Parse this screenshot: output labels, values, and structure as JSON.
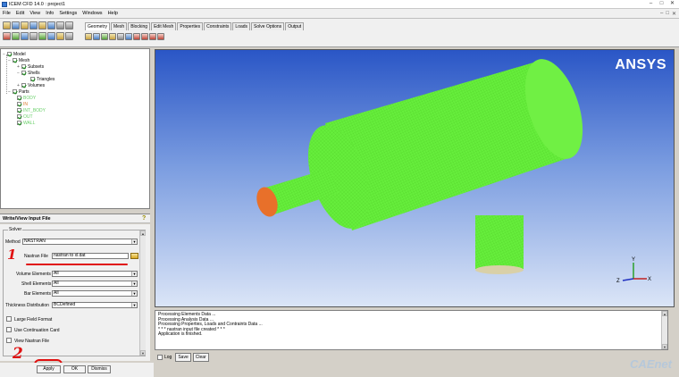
{
  "window": {
    "title": "ICEM CFD 14.0 : project1",
    "controls": [
      "–",
      "□",
      "✕"
    ]
  },
  "menu": {
    "items": [
      "File",
      "Edit",
      "View",
      "Info",
      "Settings",
      "Windows",
      "Help"
    ],
    "right_controls": [
      "–",
      "□",
      "✕"
    ]
  },
  "tabs": [
    "Geometry",
    "Mesh",
    "Blocking",
    "Edit Mesh",
    "Properties",
    "Constraints",
    "Loads",
    "Solve Options",
    "Output"
  ],
  "tree": {
    "model": "Model",
    "mesh": "Mesh",
    "subsets": "Subsets",
    "shells": "Shells",
    "triangles": "Triangles",
    "volumes": "Volumes",
    "parts": "Parts",
    "part_items": [
      "BODY",
      "IN",
      "INT_BODY",
      "OUT",
      "WALL"
    ]
  },
  "panel": {
    "title": "Write/View Input File",
    "solver_legend": "Solver",
    "method_label": "Method",
    "method_value": "NASTRAN",
    "nastran_file_label": "Nastran File",
    "nastran_file_value": "nastran to xl.dat",
    "volume_elements_label": "Volume Elements",
    "volume_elements_value": "All",
    "shell_elements_label": "Shell Elements",
    "shell_elements_value": "All",
    "bar_elements_label": "Bar Elements",
    "bar_elements_value": "All",
    "thickness_label": "Thickness Distribution",
    "thickness_value": "BCDefined",
    "large_field_label": "Large Field Format",
    "continuation_label": "Use Continuation Card",
    "view_nastran_label": "View Nastran File"
  },
  "buttons": {
    "apply": "Apply",
    "ok": "OK",
    "dismiss": "Dismiss"
  },
  "annotations": {
    "step1": "1",
    "step2": "2"
  },
  "viewport": {
    "logo": "ANSYS",
    "axes": {
      "z": "Z",
      "x": "X",
      "y": "Y"
    }
  },
  "messages": [
    "Processing Elements Data ...",
    "Processing Analysis Data ...",
    "Processing Properties, Loads and Contraints Data ...",
    "* * * nastran input file created * * *",
    "Application is finished."
  ],
  "message_controls": {
    "log": "Log",
    "save": "Save",
    "clear": "Clear"
  },
  "watermark": "CAEnet",
  "colors": {
    "mesh_green": "#66ee3c",
    "inlet_orange": "#e8702a",
    "annotation_red": "#e01010"
  }
}
